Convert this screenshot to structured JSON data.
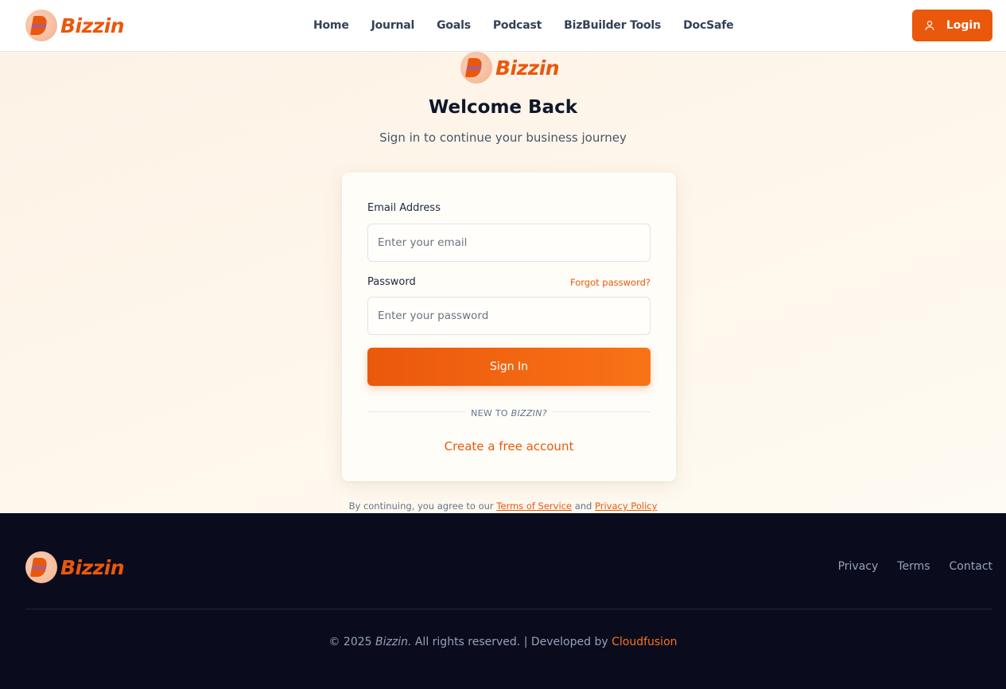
{
  "brand": {
    "name": "Bizzin",
    "accent": "#ea580c",
    "logo_icon": "bizzin-b-logo"
  },
  "nav": {
    "items": [
      {
        "label": "Home"
      },
      {
        "label": "Journal"
      },
      {
        "label": "Goals"
      },
      {
        "label": "Podcast"
      },
      {
        "label": "BizBuilder Tools"
      },
      {
        "label": "DocSafe"
      }
    ],
    "login_label": "Login",
    "login_icon": "user-icon"
  },
  "login": {
    "title": "Welcome Back",
    "subtitle": "Sign in to continue your business journey",
    "email_label": "Email Address",
    "email_placeholder": "Enter your email",
    "password_label": "Password",
    "password_placeholder": "Enter your password",
    "forgot_label": "Forgot password?",
    "signin_label": "Sign In",
    "divider_prefix": "NEW TO ",
    "divider_brand": "BIZZIN?",
    "create_label": "Create a free account"
  },
  "terms": {
    "prefix": "By continuing, you agree to our ",
    "terms_label": "Terms of Service",
    "joiner": " and ",
    "privacy_label": "Privacy Policy"
  },
  "footer": {
    "links": [
      {
        "label": "Privacy"
      },
      {
        "label": "Terms"
      },
      {
        "label": "Contact"
      }
    ],
    "copyright_prefix": "© 2025 ",
    "copyright_brand": "Bizzin.",
    "copyright_suffix": " All rights reserved. | Developed by ",
    "developer": "Cloudfusion"
  }
}
